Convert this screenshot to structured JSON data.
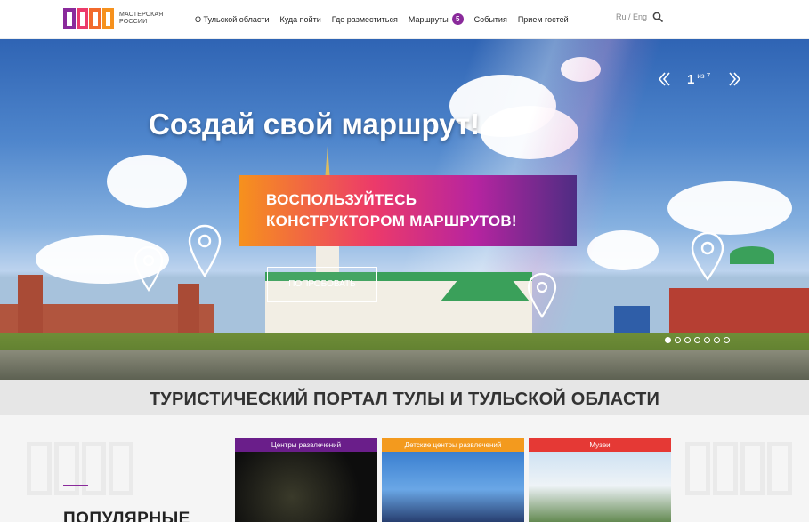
{
  "header": {
    "logo_text_line1": "МАСТЕРСКАЯ",
    "logo_text_line2": "РОССИИ",
    "nav": [
      {
        "label": "О Тульской области"
      },
      {
        "label": "Куда пойти"
      },
      {
        "label": "Где разместиться"
      },
      {
        "label": "Маршруты",
        "badge": "5"
      },
      {
        "label": "События"
      },
      {
        "label": "Прием гостей"
      }
    ],
    "lang": "Ru / Eng"
  },
  "hero": {
    "title": "Создай свой маршрут!",
    "banner_line1": "ВОСПОЛЬЗУЙТЕСЬ",
    "banner_line2": "КОНСТРУКТОРОМ МАРШРУТОВ!",
    "button_label": "ПОПРОБОВАТЬ",
    "slide_current": "1",
    "slide_of": "из 7",
    "slide_total": 7,
    "slide_active_index": 0
  },
  "portal_title": "ТУРИСТИЧЕСКИЙ ПОРТАЛ ТУЛЫ И ТУЛЬСКОЙ ОБЛАСТИ",
  "section": {
    "heading": "ПОПУЛЯРНЫЕ"
  },
  "cards": [
    {
      "label": "Центры развлечений",
      "color": "#6a1e8a"
    },
    {
      "label": "Детские центры развлечений",
      "color": "#f39a1e"
    },
    {
      "label": "Музеи",
      "color": "#e53935"
    }
  ],
  "colors": {
    "brand_purple": "#8a2a9b",
    "brand_orange": "#f6911d",
    "brand_pink": "#ec3a6a"
  }
}
